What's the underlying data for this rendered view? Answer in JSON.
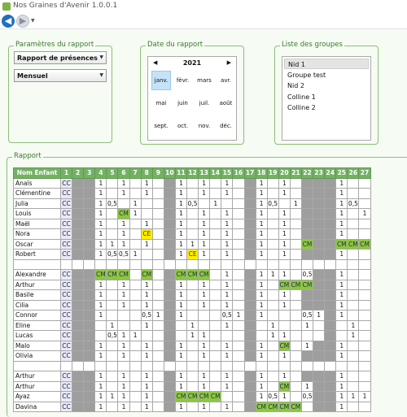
{
  "window": {
    "title": "Nos Graines d'Avenir 1.0.0.1"
  },
  "nav": {
    "back_glyph": "◀",
    "forward_glyph": "▶",
    "dropdown_glyph": "▼"
  },
  "params": {
    "label": "Paramètres du rapport",
    "report_type": "Rapport de présences",
    "period": "Mensuel",
    "arrow": "▼"
  },
  "date": {
    "label": "Date du rapport",
    "year": "2021",
    "prev": "◀",
    "next": "▶",
    "months": [
      "janv.",
      "févr.",
      "mars",
      "avr.",
      "mai",
      "juin",
      "juil.",
      "août",
      "sept.",
      "oct.",
      "nov.",
      "déc."
    ],
    "selected_month": "janv."
  },
  "groups": {
    "label": "Liste des groupes",
    "items": [
      "Nid 1",
      "Groupe test",
      "Nid 2",
      "Colline 1",
      "Colline 2"
    ],
    "selected": "Nid 1"
  },
  "report": {
    "label": "Rapport",
    "name_header": "Nom Enfant",
    "day_headers": [
      "1",
      "2",
      "3",
      "4",
      "5",
      "6",
      "7",
      "8",
      "9",
      "10",
      "11",
      "12",
      "13",
      "14",
      "15",
      "16",
      "17",
      "18",
      "19",
      "20",
      "21",
      "22",
      "23",
      "24",
      "25",
      "26",
      "27"
    ],
    "rows": [
      {
        "name": "Anaïs",
        "cells": [
          "CC",
          "g",
          "g",
          "1",
          "",
          "1",
          "",
          "1",
          "",
          "g",
          "1",
          "",
          "1",
          "",
          "1",
          "",
          "g",
          "1",
          "",
          "1",
          "",
          "g",
          "g",
          "g",
          "1",
          "",
          ""
        ]
      },
      {
        "name": "Clémentine",
        "cells": [
          "CC",
          "g",
          "g",
          "1",
          "",
          "1",
          "",
          "1",
          "",
          "g",
          "1",
          "",
          "1",
          "",
          "1",
          "",
          "g",
          "1",
          "",
          "1",
          "",
          "g",
          "g",
          "g",
          "1",
          "",
          ""
        ]
      },
      {
        "name": "Julia",
        "cells": [
          "CC",
          "g",
          "g",
          "1",
          "0,5",
          "",
          "1",
          "",
          "",
          "g",
          "1",
          "0,5",
          "",
          "1",
          "",
          "",
          "g",
          "1",
          "0,5",
          "",
          "1",
          "g",
          "g",
          "g",
          "1",
          "0,5",
          ""
        ]
      },
      {
        "name": "Louis",
        "cells": [
          "CC",
          "g",
          "g",
          "1",
          "",
          "CM",
          "1",
          "",
          "",
          "g",
          "1",
          "",
          "1",
          "",
          "1",
          "",
          "g",
          "1",
          "",
          "1",
          "",
          "g",
          "g",
          "g",
          "1",
          "",
          "1"
        ]
      },
      {
        "name": "Maël",
        "cells": [
          "CC",
          "g",
          "g",
          "1",
          "",
          "1",
          "",
          "1",
          "",
          "g",
          "1",
          "",
          "1",
          "",
          "1",
          "",
          "g",
          "1",
          "",
          "1",
          "",
          "g",
          "g",
          "g",
          "1",
          "",
          ""
        ]
      },
      {
        "name": "Nora",
        "cells": [
          "CC",
          "g",
          "g",
          "1",
          "",
          "1",
          "",
          "CE",
          "",
          "g",
          "1",
          "",
          "1",
          "",
          "1",
          "",
          "g",
          "1",
          "",
          "1",
          "",
          "g",
          "g",
          "g",
          "1",
          "",
          ""
        ]
      },
      {
        "name": "Oscar",
        "cells": [
          "CC",
          "g",
          "g",
          "1",
          "1",
          "1",
          "",
          "1",
          "",
          "g",
          "1",
          "1",
          "1",
          "",
          "1",
          "",
          "g",
          "1",
          "",
          "1",
          "",
          "CM",
          "g",
          "g",
          "CM",
          "CM",
          "CM"
        ]
      },
      {
        "name": "Robert",
        "cells": [
          "CC",
          "g",
          "g",
          "1",
          "0,5",
          "0,5",
          "1",
          "",
          "",
          "g",
          "1",
          "CE",
          "1",
          "",
          "1",
          "",
          "g",
          "1",
          "",
          "1",
          "",
          "g",
          "g",
          "g",
          "1",
          "",
          ""
        ]
      },
      {
        "name": "",
        "cells": [
          "",
          "",
          "",
          "",
          "",
          "",
          "",
          "",
          "",
          "",
          "",
          "",
          "",
          "",
          "",
          "",
          "",
          "",
          "",
          "",
          "",
          "",
          "",
          "",
          "",
          "",
          ""
        ]
      },
      {
        "name": "Alexandre",
        "cells": [
          "CC",
          "g",
          "g",
          "CM",
          "CM",
          "CM",
          "",
          "CM",
          "",
          "g",
          "CM",
          "CM",
          "CM",
          "",
          "1",
          "",
          "g",
          "1",
          "1",
          "1",
          "",
          "0,5",
          "g",
          "g",
          "1",
          "",
          ""
        ]
      },
      {
        "name": "Arthur",
        "cells": [
          "CC",
          "g",
          "g",
          "1",
          "",
          "1",
          "",
          "1",
          "",
          "g",
          "1",
          "",
          "1",
          "",
          "1",
          "",
          "g",
          "1",
          "",
          "CM",
          "CM",
          "CM",
          "g",
          "g",
          "1",
          "",
          ""
        ]
      },
      {
        "name": "Basile",
        "cells": [
          "CC",
          "g",
          "g",
          "1",
          "",
          "1",
          "",
          "1",
          "",
          "g",
          "1",
          "",
          "1",
          "",
          "1",
          "",
          "g",
          "1",
          "",
          "1",
          "",
          "g",
          "g",
          "g",
          "1",
          "",
          ""
        ]
      },
      {
        "name": "Cilia",
        "cells": [
          "CC",
          "g",
          "g",
          "1",
          "",
          "1",
          "",
          "1",
          "",
          "g",
          "1",
          "",
          "1",
          "",
          "1",
          "",
          "g",
          "1",
          "",
          "1",
          "",
          "g",
          "g",
          "g",
          "1",
          "",
          ""
        ]
      },
      {
        "name": "Connor",
        "cells": [
          "CC",
          "g",
          "g",
          "1",
          "",
          "",
          "",
          "0,5",
          "1",
          "g",
          "1",
          "",
          "",
          "",
          "0,5",
          "1",
          "g",
          "1",
          "",
          "",
          "",
          "0,5",
          "1",
          "g",
          "1",
          "",
          ""
        ]
      },
      {
        "name": "Eline",
        "cells": [
          "CC",
          "g",
          "g",
          "",
          "1",
          "",
          "",
          "1",
          "",
          "g",
          "",
          "1",
          "",
          "",
          "1",
          "",
          "g",
          "",
          "1",
          "",
          "",
          "1",
          "",
          "g",
          "",
          "1",
          ""
        ]
      },
      {
        "name": "Lucas",
        "cells": [
          "CC",
          "g",
          "g",
          "",
          "0,5",
          "1",
          "1",
          "",
          "",
          "g",
          "",
          "1",
          "1",
          "",
          "",
          "",
          "g",
          "",
          "1",
          "1",
          "",
          "",
          "",
          "g",
          "",
          "1",
          ""
        ]
      },
      {
        "name": "Malo",
        "cells": [
          "CC",
          "g",
          "g",
          "1",
          "",
          "1",
          "",
          "1",
          "",
          "g",
          "1",
          "",
          "1",
          "",
          "1",
          "",
          "g",
          "1",
          "",
          "CM",
          "",
          "1",
          "g",
          "g",
          "1",
          "",
          ""
        ]
      },
      {
        "name": "Olivia",
        "cells": [
          "CC",
          "g",
          "g",
          "1",
          "",
          "1",
          "",
          "1",
          "",
          "g",
          "1",
          "",
          "1",
          "",
          "1",
          "",
          "g",
          "1",
          "",
          "1",
          "",
          "g",
          "g",
          "g",
          "1",
          "",
          ""
        ]
      },
      {
        "name": "",
        "cells": [
          "",
          "",
          "",
          "",
          "",
          "",
          "",
          "",
          "",
          "",
          "",
          "",
          "",
          "",
          "",
          "",
          "",
          "",
          "",
          "",
          "",
          "",
          "",
          "",
          "",
          "",
          ""
        ]
      },
      {
        "name": "Arthur",
        "cells": [
          "CC",
          "g",
          "g",
          "1",
          "",
          "1",
          "",
          "1",
          "",
          "g",
          "1",
          "",
          "1",
          "",
          "1",
          "",
          "g",
          "1",
          "",
          "1",
          "",
          "g",
          "g",
          "g",
          "1",
          "",
          ""
        ]
      },
      {
        "name": "Arthur",
        "cells": [
          "CC",
          "g",
          "g",
          "1",
          "",
          "1",
          "",
          "1",
          "",
          "g",
          "1",
          "",
          "1",
          "",
          "1",
          "",
          "g",
          "1",
          "",
          "CM",
          "",
          "1",
          "g",
          "g",
          "1",
          "",
          ""
        ]
      },
      {
        "name": "Ayaz",
        "cells": [
          "CC",
          "g",
          "g",
          "1",
          "1",
          "1",
          "",
          "1",
          "",
          "g",
          "CM",
          "CM",
          "CM",
          "CM",
          "",
          "",
          "g",
          "1",
          "0,5",
          "1",
          "",
          "0,5",
          "g",
          "g",
          "1",
          "1",
          "1"
        ]
      },
      {
        "name": "Davina",
        "cells": [
          "CC",
          "g",
          "g",
          "1",
          "",
          "1",
          "",
          "1",
          "",
          "g",
          "1",
          "",
          "1",
          "",
          "1",
          "",
          "g",
          "CM",
          "CM",
          "CM",
          "CM",
          "",
          "g",
          "g",
          "1",
          "",
          ""
        ]
      }
    ]
  }
}
